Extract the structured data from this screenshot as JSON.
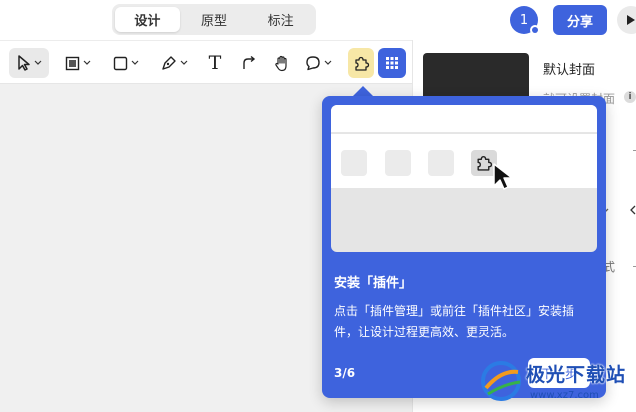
{
  "header": {
    "tabs": [
      {
        "label": "设计",
        "active": true
      },
      {
        "label": "原型",
        "active": false
      },
      {
        "label": "标注",
        "active": false
      }
    ],
    "avatar_label": "1",
    "share_label": "分享"
  },
  "toolbar": {
    "tools": [
      "move-tool",
      "frame-tool",
      "shape-tool",
      "pen-tool",
      "text-tool",
      "connector-tool",
      "hand-tool",
      "comment-tool",
      "plugin-tool",
      "resources-tool"
    ],
    "text_glyph": "T",
    "active_tool": "plugin-tool"
  },
  "right_panel": {
    "cover_title": "默认封面",
    "cover_subtitle": "就可设置封面",
    "info_glyph": "i",
    "fragment_text": "式"
  },
  "popover": {
    "title": "安装「插件」",
    "body": "点击「插件管理」或前往「插件社区」安装插件，让设计过程更高效、更灵活。",
    "step": "3/6",
    "next_label": "下一步"
  },
  "watermark": {
    "text": "极光下载站",
    "url": "www.xz7.com"
  },
  "colors": {
    "accent": "#3e63dd",
    "plugin_highlight": "#f7e7a6",
    "canvas": "#f0f0f0"
  }
}
